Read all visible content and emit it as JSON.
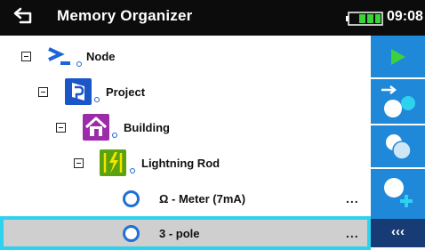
{
  "header": {
    "title": "Memory Organizer",
    "time": "09:08",
    "back_icon": "back-arrow-icon",
    "battery_icon": "battery-icon"
  },
  "tree": {
    "items": [
      {
        "label": "Node",
        "icon": "node-icon",
        "level": 0
      },
      {
        "label": "Project",
        "icon": "project-icon",
        "level": 1
      },
      {
        "label": "Building",
        "icon": "building-icon",
        "level": 2
      },
      {
        "label": "Lightning Rod",
        "icon": "lightning-rod-icon",
        "level": 3
      },
      {
        "label": "Ω - Meter (7mA)",
        "icon": "measurement-icon",
        "level": 4,
        "more": "..."
      },
      {
        "label": "3 - pole",
        "icon": "measurement-icon",
        "level": 4,
        "more": "...",
        "selected": true
      }
    ]
  },
  "sidebar": {
    "buttons": [
      {
        "name": "start-test-button",
        "icon": "play-icon"
      },
      {
        "name": "move-button",
        "icon": "move-icon"
      },
      {
        "name": "clone-button",
        "icon": "clone-icon"
      },
      {
        "name": "add-button",
        "icon": "add-icon"
      }
    ],
    "more_label": "‹‹‹"
  },
  "colors": {
    "header_bg": "#0c0c0c",
    "sidebar_bg": "#1f88d9",
    "selected_border": "#2fd2ee",
    "selected_bg": "#cfcfcf",
    "accent_blue": "#1f6fd8",
    "play_green": "#3cd23c"
  }
}
